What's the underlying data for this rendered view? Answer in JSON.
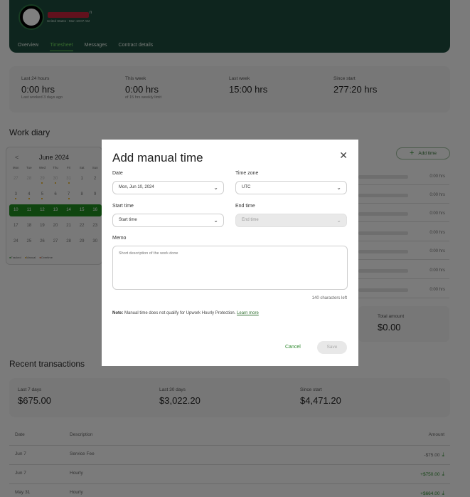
{
  "header": {
    "name_suffix": "n",
    "subline": "United States - Mon 10:07 AM",
    "tabs": [
      {
        "label": "Overview"
      },
      {
        "label": "Timesheet"
      },
      {
        "label": "Messages"
      },
      {
        "label": "Contract details"
      }
    ],
    "active_tab": "Timesheet"
  },
  "stats": [
    {
      "label": "Last 24 hours",
      "value": "0:00 hrs",
      "sub": "Last worked 3 days ago"
    },
    {
      "label": "This week",
      "value": "0:00 hrs",
      "sub": "of 15 hrs weekly limit"
    },
    {
      "label": "Last week",
      "value": "15:00 hrs",
      "sub": ""
    },
    {
      "label": "Since start",
      "value": "277:20 hrs",
      "sub": ""
    }
  ],
  "work_diary": {
    "title": "Work diary",
    "add_time_label": "Add time",
    "calendar": {
      "prev": "<",
      "month": "June 2024",
      "dow": [
        "Mon",
        "Tue",
        "Wed",
        "Thu",
        "Fri",
        "Sat",
        "Sun"
      ],
      "weeks": [
        [
          "27",
          "28",
          "29",
          "30",
          "31",
          "1",
          "2"
        ],
        [
          "3",
          "4",
          "5",
          "6",
          "7",
          "8",
          "9"
        ],
        [
          "10",
          "11",
          "12",
          "13",
          "14",
          "15",
          "16"
        ],
        [
          "17",
          "18",
          "19",
          "20",
          "21",
          "22",
          "23"
        ],
        [
          "24",
          "25",
          "26",
          "27",
          "28",
          "29",
          "30"
        ]
      ],
      "legend": [
        "Tracked",
        "Manual",
        "Overtime"
      ]
    },
    "rows": [
      "0:00 hrs",
      "0:00 hrs",
      "0:00 hrs",
      "0:00 hrs",
      "0:00 hrs",
      "0:00 hrs",
      "0:00 hrs"
    ],
    "total_label": "Total amount",
    "total_value": "$0.00"
  },
  "transactions": {
    "title": "Recent transactions",
    "stats": [
      {
        "label": "Last 7 days",
        "value": "$675.00"
      },
      {
        "label": "Last 30 days",
        "value": "$3,022.20"
      },
      {
        "label": "Since start",
        "value": "$4,471.20"
      }
    ],
    "columns": [
      "Date",
      "Description",
      "Amount"
    ],
    "rows": [
      {
        "date": "Jun 7",
        "description": "Service Fee",
        "amount": "-$75.00"
      },
      {
        "date": "Jun 7",
        "description": "Hourly",
        "amount": "+$750.00"
      },
      {
        "date": "May 31",
        "description": "Hourly",
        "amount": "+$664.00"
      }
    ]
  },
  "modal": {
    "title": "Add manual time",
    "close": "✕",
    "date_label": "Date",
    "date_value": "Mon, Jun 10, 2024",
    "timezone_label": "Time zone",
    "timezone_value": "UTC",
    "start_label": "Start time",
    "start_value": "Start time",
    "end_label": "End time",
    "end_value": "End time",
    "memo_label": "Memo",
    "memo_placeholder": "Short description of the work done",
    "chars_left": "140 characters left",
    "note_prefix": "Note:",
    "note_text": " Manual time does not qualify for Upwork Hourly Protection. ",
    "learn_more": "Learn more",
    "cancel": "Cancel",
    "save": "Save"
  }
}
